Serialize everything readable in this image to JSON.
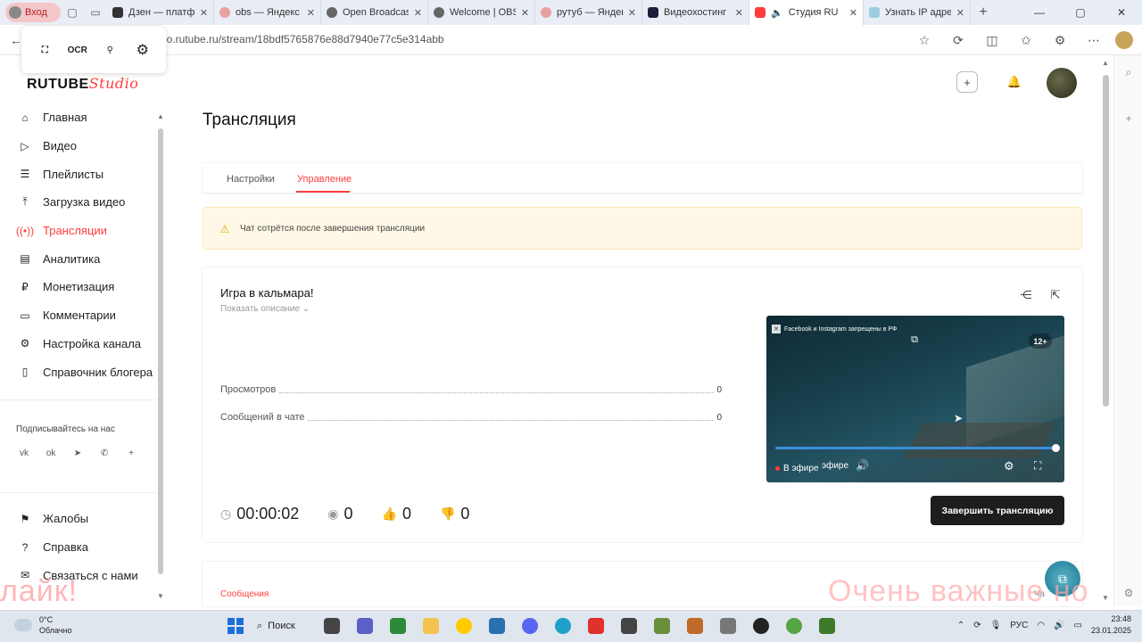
{
  "browser": {
    "profile_label": "Вход",
    "tabs": [
      {
        "title": "Дзен — платф",
        "favicon_color": "#333333"
      },
      {
        "title": "obs — Яндекс",
        "favicon_color": "#e8a0a0"
      },
      {
        "title": "Open Broadcas",
        "favicon_color": "#666666"
      },
      {
        "title": "Welcome | OBS",
        "favicon_color": "#666666"
      },
      {
        "title": "рутуб — Яндек",
        "favicon_color": "#e8a0a0"
      },
      {
        "title": "Видеохостинг",
        "favicon_color": "#1d1d3a"
      },
      {
        "title": "Студия RU",
        "favicon_color": "#ff3d3d"
      },
      {
        "title": "Узнать IP адре",
        "favicon_color": "#9ccde0"
      }
    ],
    "new_tab": "+",
    "url": "io.rutube.ru/stream/18bdf5765876e88d7940e77c5e314abb"
  },
  "floating_toolbar": {
    "items": [
      "screenshot-icon",
      "OCR",
      "pin-icon",
      "gear-icon"
    ],
    "ocr_label": "OCR"
  },
  "logo": {
    "brand": "RUTUBE",
    "suffix": "Studio"
  },
  "sidebar": {
    "items": [
      {
        "label": "Главная",
        "icon": "home-icon"
      },
      {
        "label": "Видео",
        "icon": "video-icon"
      },
      {
        "label": "Плейлисты",
        "icon": "playlist-icon"
      },
      {
        "label": "Загрузка видео",
        "icon": "upload-icon"
      },
      {
        "label": "Трансляции",
        "icon": "broadcast-icon"
      },
      {
        "label": "Аналитика",
        "icon": "analytics-icon"
      },
      {
        "label": "Монетизация",
        "icon": "monetization-icon"
      },
      {
        "label": "Комментарии",
        "icon": "comments-icon"
      },
      {
        "label": "Настройка канала",
        "icon": "settings-icon"
      },
      {
        "label": "Справочник блогера",
        "icon": "book-icon"
      }
    ],
    "active_index": 4,
    "subscribe_label": "Подписывайтесь на нас",
    "socials": [
      "vk",
      "ok",
      "telegram",
      "viber",
      "+"
    ],
    "bottom_items": [
      {
        "label": "Жалобы",
        "icon": "flag-icon"
      },
      {
        "label": "Справка",
        "icon": "help-icon"
      },
      {
        "label": "Связаться с нами",
        "icon": "mail-icon"
      }
    ]
  },
  "page": {
    "title": "Трансляция",
    "tabs": [
      {
        "label": "Настройки"
      },
      {
        "label": "Управление"
      }
    ],
    "active_tab": 1,
    "warning": "Чат сотрётся после завершения трансляции"
  },
  "stream": {
    "title": "Игра в кальмара!",
    "show_description": "Показать описание",
    "stats": [
      {
        "label": "Просмотров",
        "value": "0"
      },
      {
        "label": "Сообщений в чате",
        "value": "0"
      }
    ],
    "duration": "00:00:02",
    "viewers": "0",
    "likes": "0",
    "dislikes": "0",
    "end_button": "Завершить трансляцию"
  },
  "player": {
    "ticker": "Facebook и Instagram запрещены в РФ",
    "age_rating": "12+",
    "live_label": "В эфире",
    "live_label_overlap": "эфире",
    "progress": 1.0
  },
  "messages": {
    "title": "Сообщения",
    "right_label": "Ча"
  },
  "overlays": {
    "left_text": "лайк!",
    "right_text": "Очень важные но"
  },
  "taskbar": {
    "temperature": "0°C",
    "weather": "Облачно",
    "search_label": "Поиск",
    "language": "РУС",
    "time": "23:48",
    "date": "23.01.2025"
  }
}
